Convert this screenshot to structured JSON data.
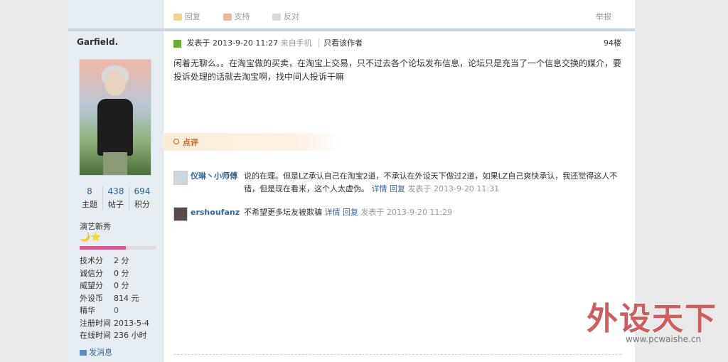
{
  "actions": {
    "reply": "回复",
    "support": "支持",
    "oppose": "反对",
    "report": "举报"
  },
  "user": {
    "name": "Garfield.",
    "stats": [
      {
        "value": "8",
        "label": "主题"
      },
      {
        "value": "438",
        "label": "帖子"
      },
      {
        "value": "694",
        "label": "积分"
      }
    ],
    "rank": "演艺新秀",
    "medals": "🌙⭐",
    "progress": 0.6,
    "info": [
      {
        "k": "技术分",
        "v": "2 分"
      },
      {
        "k": "诚信分",
        "v": "0 分"
      },
      {
        "k": "威望分",
        "v": "0 分"
      },
      {
        "k": "外设币",
        "v": "814 元"
      },
      {
        "k": "精华",
        "v": "0"
      },
      {
        "k": "注册时间",
        "v": "2013-5-4"
      },
      {
        "k": "在线时间",
        "v": "236 小时"
      }
    ],
    "send_msg": "发消息"
  },
  "post": {
    "posted_label": "发表于 2013-9-20 11:27",
    "from": "来自手机",
    "only_author": "只看该作者",
    "floor": "94楼",
    "content": "闲着无聊么。。在淘宝做的买卖，在淘宝上交易，只不过去各个论坛发布信息，论坛只是充当了一个信息交换的媒介，要投诉处理的话就去淘宝啊，找中间人投诉干嘛"
  },
  "review": {
    "title": "点评"
  },
  "comments": [
    {
      "user": "仪琳丶小师傅",
      "text": "说的在理。但是LZ承认自己在淘宝2道，不承认在外设天下做过2道，如果LZ自己爽快承认，我还觉得这人不错，但是现在看来，这个人太虚伪。",
      "detail": "详情",
      "reply": "回复",
      "time": "发表于 2013-9-20 11:31"
    },
    {
      "user": "ershoufanz",
      "text": "不希望更多坛友被欺骗",
      "detail": "详情",
      "reply": "回复",
      "time": "发表于 2013-9-20 11:29"
    }
  ],
  "watermark": {
    "big": "外设天下",
    "url": "www.pcwaishe.cn"
  }
}
